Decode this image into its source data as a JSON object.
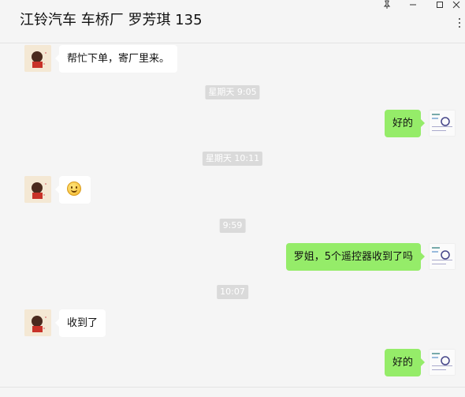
{
  "window": {
    "title": "江铃汽车 车桥厂 罗芳琪 135",
    "pin_icon": "pin-icon",
    "minimize_icon": "minimize-icon",
    "maximize_icon": "maximize-icon",
    "close_icon": "close-icon",
    "more_icon": "more-dots-icon"
  },
  "messages": [
    {
      "type": "message",
      "side": "left",
      "text": "帮忙下单，寄厂里来。"
    },
    {
      "type": "timestamp",
      "text": "星期天 9:05"
    },
    {
      "type": "message",
      "side": "right",
      "text": "好的"
    },
    {
      "type": "timestamp",
      "text": "星期天 10:11"
    },
    {
      "type": "message",
      "side": "left",
      "emoji": "smile-emoji"
    },
    {
      "type": "timestamp",
      "text": "9:59"
    },
    {
      "type": "message",
      "side": "right",
      "text": "罗姐，5个遥控器收到了吗"
    },
    {
      "type": "timestamp",
      "text": "10:07"
    },
    {
      "type": "message",
      "side": "left",
      "text": "收到了"
    },
    {
      "type": "message",
      "side": "right",
      "text": "好的"
    }
  ],
  "colors": {
    "self_bubble": "#95ec69",
    "other_bubble": "#ffffff",
    "background": "#f5f5f5",
    "timestamp_bg": "#dadada"
  }
}
